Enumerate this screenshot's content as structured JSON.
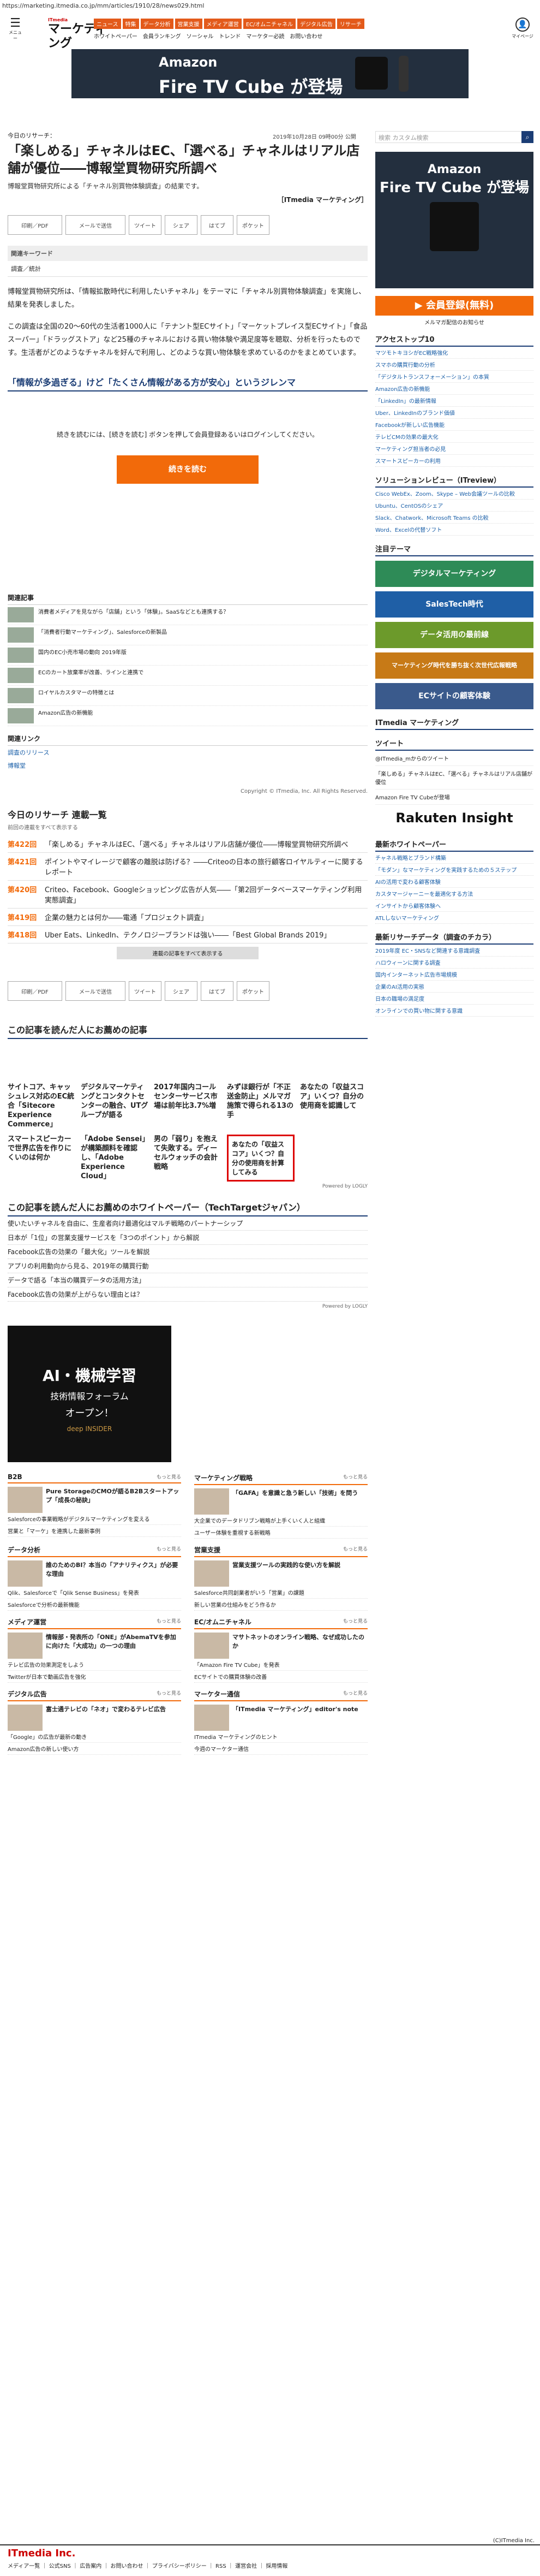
{
  "url": "https://marketing.itmedia.co.jp/mm/articles/1910/28/news029.html",
  "header": {
    "menu_label": "メニュー",
    "logo_small": "ITmedia",
    "logo_big": "マーケティング",
    "user_label": "マイページ",
    "nav1": [
      "ニュース",
      "特集",
      "データ分析",
      "営業支援",
      "メディア運営",
      "EC/オムニチャネル",
      "デジタル広告",
      "リサーチ"
    ],
    "nav2": [
      "ホワイトペーパー",
      "会員ランキング",
      "ソーシャル",
      "トレンド",
      "マーケター必読",
      "お問い合わせ"
    ]
  },
  "top_ad": {
    "line1": "Amazon",
    "line2": "Fire TV Cube が登場"
  },
  "article": {
    "date": "2019年10月28日 09時00分 公開",
    "eyebrow": "今日のリサーチ：",
    "title": "「楽しめる」チャネルはEC、「選べる」チャネルはリアル店舗が優位――博報堂買物研究所調べ",
    "lead": "博報堂買物研究所による「チャネル別買物体験調査」の結果です。",
    "byline": "［ITmedia マーケティング］",
    "share": [
      "印刷／PDF",
      "メールで送信",
      "ツイート",
      "シェア",
      "はてブ",
      "ポケット"
    ],
    "kw_label": "関連キーワード",
    "kw": "調査／統計",
    "p1": "博報堂買物研究所は、「情報拡散時代に利用したいチャネル」をテーマに「チャネル別買物体験調査」を実施し、結果を発表しました。",
    "p2": "この調査は全国の20〜60代の生活者1000人に「テナント型ECサイト」「マーケットプレイス型ECサイト」「食品スーパー」「ドラッグストア」など25種のチャネルにおける買い物体験や満足度等を聴取、分析を行ったものです。生活者がどのようなチャネルを好んで利用し、どのような買い物体験を求めているのかをまとめています。",
    "section": "「情報が多過ぎる」けど「たくさん情報がある方が安心」というジレンマ",
    "continue": "続きを読むには、[続きを読む] ボタンを押して会員登録あるいはログインしてください。",
    "cta": "続きを読む",
    "rel_title": "関連記事",
    "rel": [
      "消費者メディアを見ながら「店舗」という「体験」。SaaSなどとも連携する？",
      "「消費者行動マーケティング」、Salesforceの新製品",
      "国内のEC小売市場の動向 2019年版",
      "ECのカート放棄率が改善、ラインと連携で",
      "ロイヤルカスタマーの特徴とは",
      "Amazon広告の新機能"
    ],
    "links_title": "関連リンク",
    "links": [
      "調査のリリース",
      "博報堂"
    ],
    "copyright": "Copyright © ITmedia, Inc. All Rights Reserved."
  },
  "ranking": {
    "title": "今日のリサーチ 連載一覧",
    "sub": "前回の連載をすべて表示する",
    "rows": [
      [
        "第422回",
        "「楽しめる」チャネルはEC、「選べる」チャネルはリアル店舗が優位――博報堂買物研究所調べ"
      ],
      [
        "第421回",
        "ポイントやマイレージで顧客の離脱は防げる？――Criteoの日本の旅行顧客ロイヤルティーに関するレポート"
      ],
      [
        "第420回",
        "Criteo、Facebook、Googleショッピング広告が人気――「第2回データベースマーケティング利用実態調査」"
      ],
      [
        "第419回",
        "企業の魅力とは何か――電通「プロジェクト調査」"
      ],
      [
        "第418回",
        "Uber Eats、LinkedIn、テクノロジーブランドは強い――「Best Global Brands 2019」"
      ]
    ],
    "more": "連載の記事をすべて表示する"
  },
  "reco": {
    "title": "この記事を読んだ人にお薦めの記事",
    "items": [
      "サイトコア、キャッシュレス対応のEC統合「Sitecore Experience Commerce」",
      "デジタルマーケティングとコンタクトセンターの融合、UTグループが語る",
      "2017年国内コールセンターサービス市場は前年比3.7%増",
      "みずほ銀行が「不正送金防止」メルマガ施策で得られる13の手",
      "あなたの「収益スコア」いくつ？自分の使用商を認識して"
    ],
    "items2": [
      "スマートスピーカーで世界広告を作りにくいのは何か",
      "「Adobe Sensei」が構築顔料を確認し、「Adobe Experience Cloud」",
      "男の「弱り」を抱えて失敗する。ディーセルウォッチの会計戦略",
      "",
      ""
    ],
    "ad_text": "あなたの「収益スコア」いくつ？自分の使用商を計算してみる",
    "powered": "Powered by LOGLY"
  },
  "wp": {
    "title": "この記事を読んだ人にお薦めのホワイトペーパー（TechTargetジャパン）",
    "items": [
      "使いたいチャネルを自由に、生産者向け最適化はマルチ戦略のパートナーシップ",
      "日本が「1位」の営業支援サービスを「3つのポイント」から解説",
      "Facebook広告の効果の「最大化」ツールを解説",
      "アプリの利用動向から見る、2019年の購買行動",
      "データで語る「本当の購買データの活用方法」",
      "Facebook広告の効果が上がらない理由とは？"
    ],
    "powered": "Powered by LOGLY"
  },
  "bigad": {
    "a": "AI・機械学習",
    "b": "技術情報フォーラム",
    "c": "オープン！",
    "d": "deep INSIDER"
  },
  "cats": [
    {
      "name": "B2B",
      "more": "もっと見る",
      "top": "Pure StorageのCMOが語るB2Bスタートアップ「成長の秘訣」",
      "items": [
        "Salesforceの事業戦略がデジタルマーケティングを変える",
        "営業と「マーケ」を連携した最新事例"
      ]
    },
    {
      "name": "マーケティング戦略",
      "more": "もっと見る",
      "top": "「GAFA」を意識と急う新しい「技術」を問う",
      "items": [
        "大企業でのデータドリブン戦略が上手くいく人と組織",
        "ユーザー体験を重視する新戦略"
      ]
    },
    {
      "name": "データ分析",
      "more": "もっと見る",
      "top": "誰のためのBI？本当の「アナリティクス」が必要な理由",
      "items": [
        "Qlik、Salesforceで「Qlik Sense Business」を発表",
        "Salesforceで分析の最新機能"
      ]
    },
    {
      "name": "営業支援",
      "more": "もっと見る",
      "top": "営業支援ツールの実践的な使い方を解説",
      "items": [
        "Salesforce共同創業者がいう「営業」の課題",
        "新しい営業の仕組みをどう作るか"
      ]
    },
    {
      "name": "メディア運営",
      "more": "もっと見る",
      "top": "情報部・発表所の「ONE」がAbemaTVを参加に向けた「大成功」の一つの理由",
      "items": [
        "テレビ広告の効果測定をしよう",
        "Twitterが日本で動画広告を強化"
      ]
    },
    {
      "name": "EC/オムニチャネル",
      "more": "もっと見る",
      "top": "マサトネットのオンライン戦略、なぜ成功したのか",
      "items": [
        "「Amazon Fire TV Cube」を発表",
        "ECサイトでの購買体験の改善"
      ]
    },
    {
      "name": "デジタル広告",
      "more": "もっと見る",
      "top": "富士通テレビの「ネオ」で変わるテレビ広告",
      "items": [
        "「Google」の広告が最新の動き",
        "Amazon広告の新しい使い方"
      ]
    },
    {
      "name": "マーケター通信",
      "more": "もっと見る",
      "top": "「ITmedia マーケティング」editor's note",
      "items": [
        "ITmedia マーケティングのヒント",
        "今週のマーケター通信"
      ]
    }
  ],
  "side": {
    "search_ph": "検索 カスタム検索",
    "ad1": "Amazon",
    "ad2": "Fire TV Cube が登場",
    "reg": "▶ 会員登録(無料)",
    "regsub": "メルマガ配信のお知らせ",
    "access_title": "アクセストップ10",
    "access": [
      "マツモトキヨシがEC戦略強化",
      "スマホの購買行動の分析",
      "「デジタルトランスフォーメーション」の本質",
      "Amazon広告の新機能",
      "「LinkedIn」の最新情報",
      "Uber、LinkedInのブランド価値",
      "Facebookが新しい広告機能",
      "テレビCMの効果の最大化",
      "マーケティング担当者の必見",
      "スマートスピーカーの利用"
    ],
    "sol_title": "ソリューションレビュー（ITreview）",
    "sol": [
      "Cisco WebEx、Zoom、Skype – Web会議ツールの比較",
      "Ubuntu、CentOSのシェア",
      "Slack、Chatwork、Microsoft Teams の比較",
      "Word、Excelの代替ソフト"
    ],
    "promo_title": "注目テーマ",
    "promos": [
      "デジタルマーケティング",
      "SalesTech時代",
      "データ活用の最前線",
      "マーケティング時代を勝ち抜く次世代広報戦略",
      "ECサイトの顧客体験"
    ],
    "fb": "ITmedia マーケティング",
    "tw": "ツイート",
    "tweets": [
      "@ITmedia_mからのツイート",
      "「楽しめる」チャネルはEC、「選べる」チャネルはリアル店舗が優位",
      "Amazon Fire TV Cubeが登場"
    ],
    "rakuten": "Rakuten Insight",
    "newwp_title": "最新ホワイトペーパー",
    "newwp": [
      "チャネル戦略とブランド構築",
      "「モダン」なマーケティングを実践するための５ステップ",
      "AIの活用で変わる顧客体験",
      "カスタマージャーニーを最適化する方法",
      "インサイトから顧客体験へ",
      "ATLしないマーケティング"
    ],
    "newres_title": "最新リサーチデータ（調査のチカラ）",
    "newres": [
      "2019年度 EC・SNSなど関連する意識調査",
      "ハロウィーンに関する調査",
      "国内インターネット広告市場規模",
      "企業のAI活用の実態",
      "日本の職場の満足度",
      "オンラインでの買い物に関する意識"
    ]
  },
  "footer": {
    "logo": "ITmedia Inc.",
    "copy": "(C)ITmedia Inc.",
    "links": "メディア一覧 ｜ 公式SNS ｜ 広告案内 ｜ お問い合わせ ｜ プライバシーポリシー ｜ RSS ｜ 運営会社 ｜ 採用情報"
  }
}
